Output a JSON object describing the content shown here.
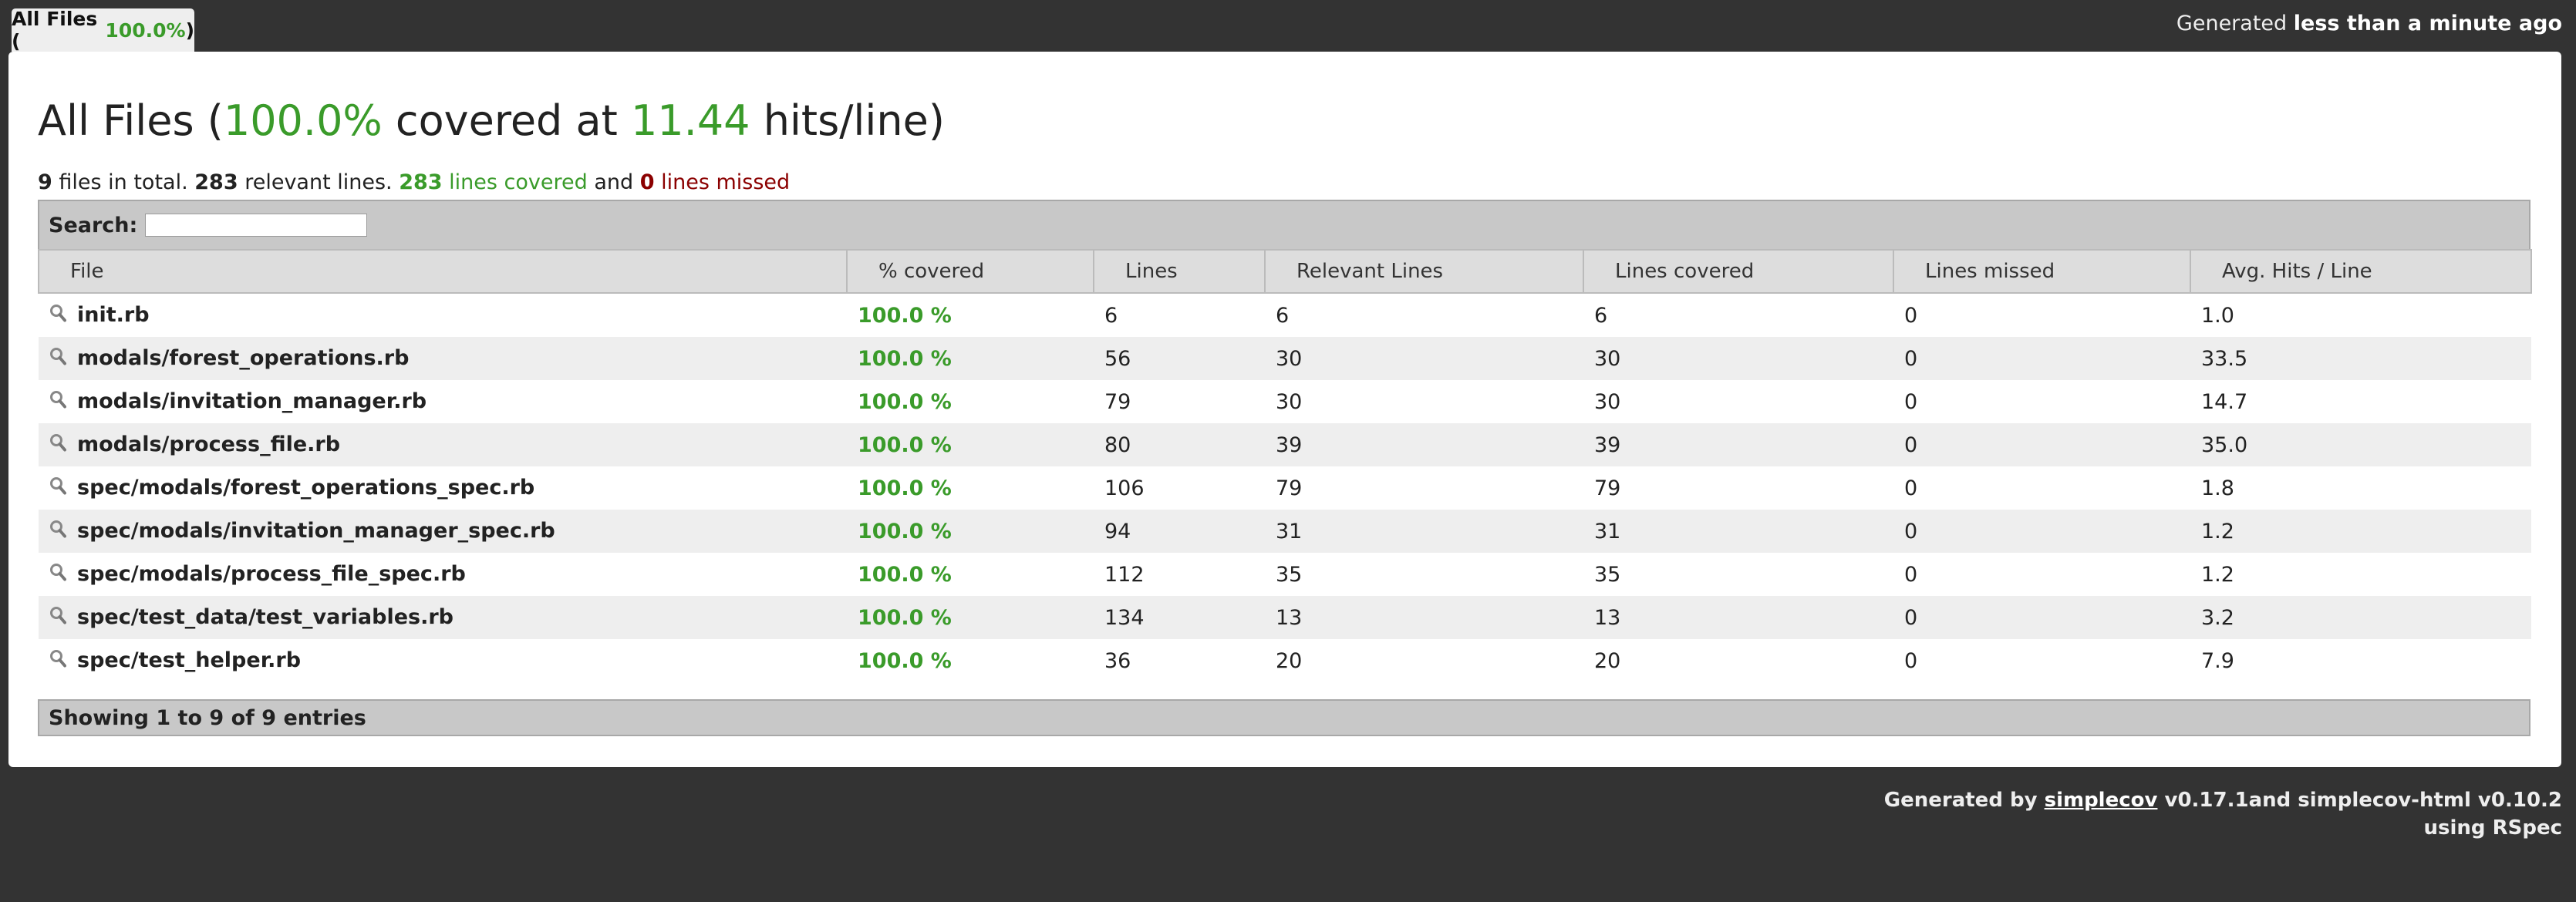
{
  "tab": {
    "label_prefix": "All Files (",
    "pct": "100.0%",
    "label_suffix": ")"
  },
  "header": {
    "generated_prefix": "Generated ",
    "generated_time": "less than a minute ago"
  },
  "title": {
    "prefix": "All Files (",
    "pct": "100.0%",
    "middle": " covered at ",
    "hits": "11.44",
    "suffix": " hits/line)"
  },
  "summary": {
    "files": "9",
    "files_text": " files in total. ",
    "relevant": "283",
    "relevant_text": " relevant lines. ",
    "covered": "283",
    "covered_text": " lines covered",
    "and": " and ",
    "missed": "0",
    "missed_text": " lines missed"
  },
  "search": {
    "label": "Search:",
    "value": ""
  },
  "columns": [
    "File",
    "% covered",
    "Lines",
    "Relevant Lines",
    "Lines covered",
    "Lines missed",
    "Avg. Hits / Line"
  ],
  "rows": [
    [
      "init.rb",
      "100.0 %",
      "6",
      "6",
      "6",
      "0",
      "1.0"
    ],
    [
      "modals/forest_operations.rb",
      "100.0 %",
      "56",
      "30",
      "30",
      "0",
      "33.5"
    ],
    [
      "modals/invitation_manager.rb",
      "100.0 %",
      "79",
      "30",
      "30",
      "0",
      "14.7"
    ],
    [
      "modals/process_file.rb",
      "100.0 %",
      "80",
      "39",
      "39",
      "0",
      "35.0"
    ],
    [
      "spec/modals/forest_operations_spec.rb",
      "100.0 %",
      "106",
      "79",
      "79",
      "0",
      "1.8"
    ],
    [
      "spec/modals/invitation_manager_spec.rb",
      "100.0 %",
      "94",
      "31",
      "31",
      "0",
      "1.2"
    ],
    [
      "spec/modals/process_file_spec.rb",
      "100.0 %",
      "112",
      "35",
      "35",
      "0",
      "1.2"
    ],
    [
      "spec/test_data/test_variables.rb",
      "100.0 %",
      "134",
      "13",
      "13",
      "0",
      "3.2"
    ],
    [
      "spec/test_helper.rb",
      "100.0 %",
      "36",
      "20",
      "20",
      "0",
      "7.9"
    ]
  ],
  "table_footer": "Showing 1 to 9 of 9 entries",
  "credits": {
    "generated_by": "Generated by ",
    "link": "simplecov",
    "rest": " v0.17.1and simplecov-html v0.10.2",
    "line2": "using RSpec"
  },
  "colors": {
    "covered": "#3a9b2a",
    "missed": "#8b0000",
    "background": "#333333"
  },
  "icons": {
    "file_row": "magnifier-icon"
  }
}
